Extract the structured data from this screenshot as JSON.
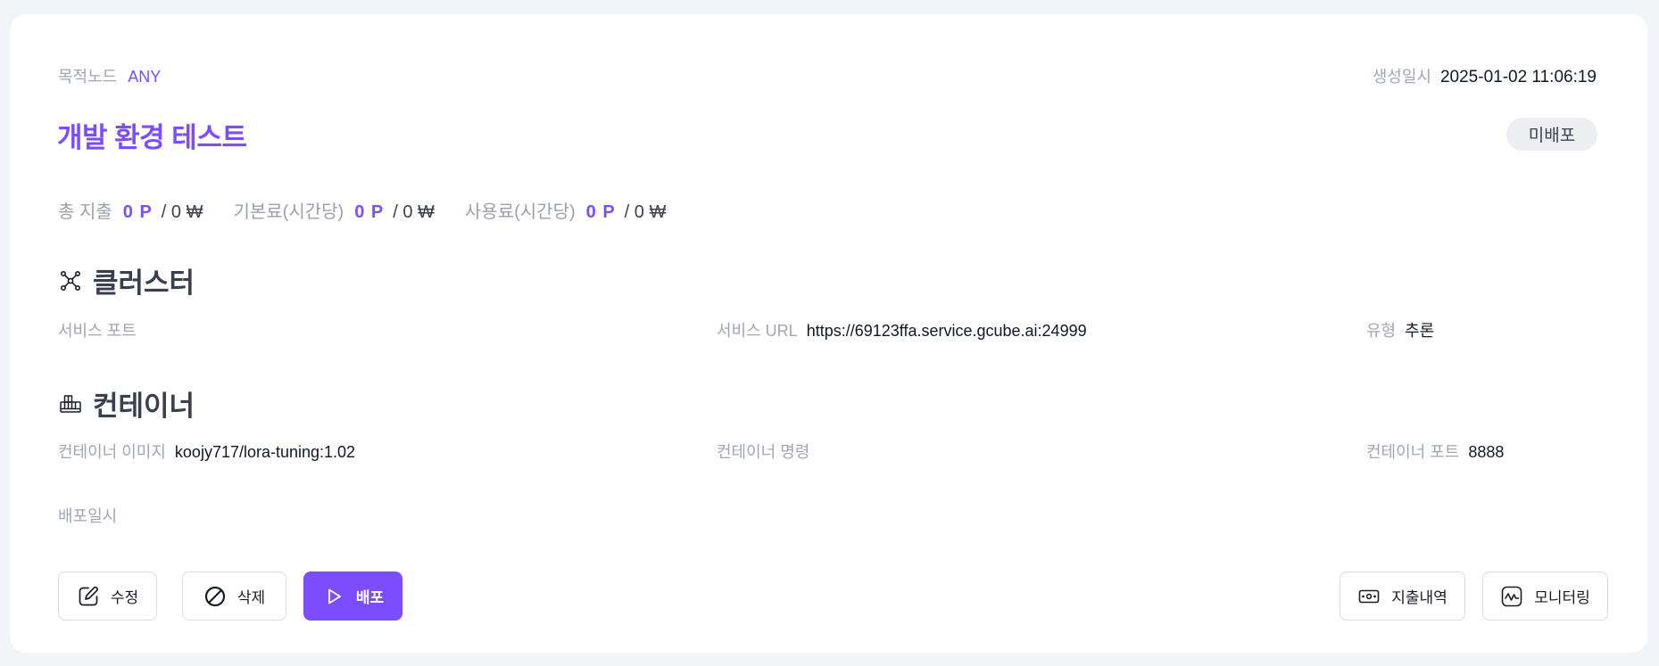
{
  "header": {
    "target_node_label": "목적노드",
    "target_node_value": "ANY",
    "created_label": "생성일시",
    "created_value": "2025-01-02 11:06:19",
    "title": "개발 환경 테스트",
    "status_badge": "미배포"
  },
  "costs": {
    "total_label": "총 지출",
    "total_points": "0 P",
    "total_won": "/ 0 ₩",
    "base_label": "기본료(시간당)",
    "base_points": "0 P",
    "base_won": "/ 0 ₩",
    "usage_label": "사용료(시간당)",
    "usage_points": "0 P",
    "usage_won": "/ 0 ₩"
  },
  "cluster": {
    "title": "클러스터",
    "icon": "cluster-network-icon",
    "service_port_label": "서비스 포트",
    "service_port_value": "",
    "service_url_label": "서비스 URL",
    "service_url_value": "https://69123ffa.service.gcube.ai:24999",
    "type_label": "유형",
    "type_value": "추론"
  },
  "container": {
    "title": "컨테이너",
    "icon": "container-icon",
    "image_label": "컨테이너 이미지",
    "image_value": "koojy717/lora-tuning:1.02",
    "command_label": "컨테이너 명령",
    "command_value": "",
    "port_label": "컨테이너 포트",
    "port_value": "8888",
    "deployed_label": "배포일시",
    "deployed_value": ""
  },
  "actions": {
    "edit_label": "수정",
    "delete_label": "삭제",
    "deploy_label": "배포",
    "expense_label": "지출내역",
    "monitoring_label": "모니터링"
  },
  "colors": {
    "accent": "#7c4dff",
    "page_bg": "#f2f4f8",
    "card_bg": "#ffffff",
    "label": "#a0a6b5"
  }
}
